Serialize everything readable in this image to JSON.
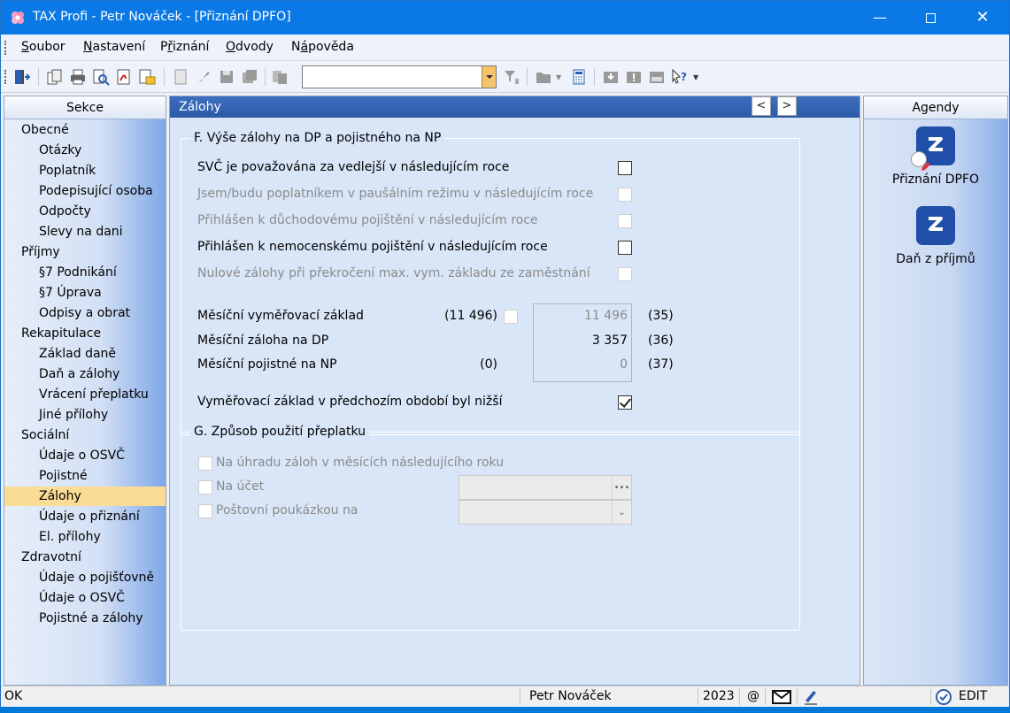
{
  "window": {
    "title": "TAX Profi - Petr Nováček - [Přiznání DPFO]"
  },
  "menu": [
    {
      "pre": "",
      "key": "S",
      "post": "oubor"
    },
    {
      "pre": "",
      "key": "N",
      "post": "astavení"
    },
    {
      "pre": "P",
      "key": "ř",
      "post": "iznání"
    },
    {
      "pre": "",
      "key": "O",
      "post": "dvody"
    },
    {
      "pre": "N",
      "key": "á",
      "post": "pověda"
    }
  ],
  "toolbar": {
    "combo_value": ""
  },
  "sections": {
    "title": "Sekce",
    "items": [
      {
        "label": "Obecné",
        "level": 1
      },
      {
        "label": "Otázky",
        "level": 2
      },
      {
        "label": "Poplatník",
        "level": 2
      },
      {
        "label": "Podepisující osoba",
        "level": 2
      },
      {
        "label": "Odpočty",
        "level": 2
      },
      {
        "label": "Slevy na dani",
        "level": 2
      },
      {
        "label": "Příjmy",
        "level": 1
      },
      {
        "label": "§7 Podnikání",
        "level": 2
      },
      {
        "label": "§7 Úprava",
        "level": 2
      },
      {
        "label": "Odpisy a obrat",
        "level": 2
      },
      {
        "label": "Rekapitulace",
        "level": 1
      },
      {
        "label": "Základ daně",
        "level": 2
      },
      {
        "label": "Daň a zálohy",
        "level": 2
      },
      {
        "label": "Vrácení přeplatku",
        "level": 2
      },
      {
        "label": "Jiné přílohy",
        "level": 2
      },
      {
        "label": "Sociální",
        "level": 1
      },
      {
        "label": "Údaje o OSVČ",
        "level": 2
      },
      {
        "label": "Pojistné",
        "level": 2
      },
      {
        "label": "Zálohy",
        "level": 2,
        "active": true
      },
      {
        "label": "Údaje o přiznání",
        "level": 2
      },
      {
        "label": "El. přílohy",
        "level": 2
      },
      {
        "label": "Zdravotní",
        "level": 1
      },
      {
        "label": "Údaje o pojišťovně",
        "level": 2
      },
      {
        "label": "Údaje o OSVČ",
        "level": 2
      },
      {
        "label": "Pojistné a zálohy",
        "level": 2
      }
    ]
  },
  "main": {
    "title": "Zálohy",
    "prev_label": "<",
    "next_label": ">",
    "groupF": {
      "title": "F. Výše zálohy na DP a pojistného na NP",
      "flags": [
        {
          "label": "SVČ je považována za vedlejší v následujícím roce",
          "enabled": true,
          "checked": false
        },
        {
          "label": "Jsem/budu poplatníkem v paušálním režimu v následujícím roce",
          "enabled": false,
          "checked": false
        },
        {
          "label": "Přihlášen k důchodovému pojištění v následujícím roce",
          "enabled": false,
          "checked": false
        },
        {
          "label": "Přihlášen k nemocenskému pojištění v následujícím roce",
          "enabled": true,
          "checked": false
        },
        {
          "label": "Nulové zálohy při překročení max. vym. základu ze zaměstnání",
          "enabled": false,
          "checked": false
        }
      ],
      "values": [
        {
          "label": "Měsíční vyměřovací základ",
          "prev": "(11 496)",
          "value": "11 496",
          "value_dim": true,
          "code": "(35)"
        },
        {
          "label": "Měsíční záloha na DP",
          "prev": "",
          "value": "3 357",
          "value_dim": false,
          "code": "(36)"
        },
        {
          "label": "Měsíční pojistné na NP",
          "prev": "(0)",
          "value": "0",
          "value_dim": true,
          "code": "(37)"
        }
      ],
      "lower_base": {
        "label": "Vyměřovací základ v předchozím období byl nižší",
        "checked": true
      }
    },
    "groupG": {
      "title": "G. Způsob použití přeplatku",
      "options": [
        {
          "label": "Na úhradu záloh v měsících následujícího roku"
        },
        {
          "label": "Na účet",
          "field_value": ""
        },
        {
          "label": "Poštovní poukázkou na",
          "field_value": ""
        }
      ]
    }
  },
  "agendas": {
    "title": "Agendy",
    "items": [
      {
        "label": "Přiznání DPFO"
      },
      {
        "label": "Daň z příjmů"
      }
    ]
  },
  "status": {
    "left": "OK",
    "user": "Petr Nováček",
    "year": "2023",
    "at": "@",
    "mode": "EDIT"
  }
}
